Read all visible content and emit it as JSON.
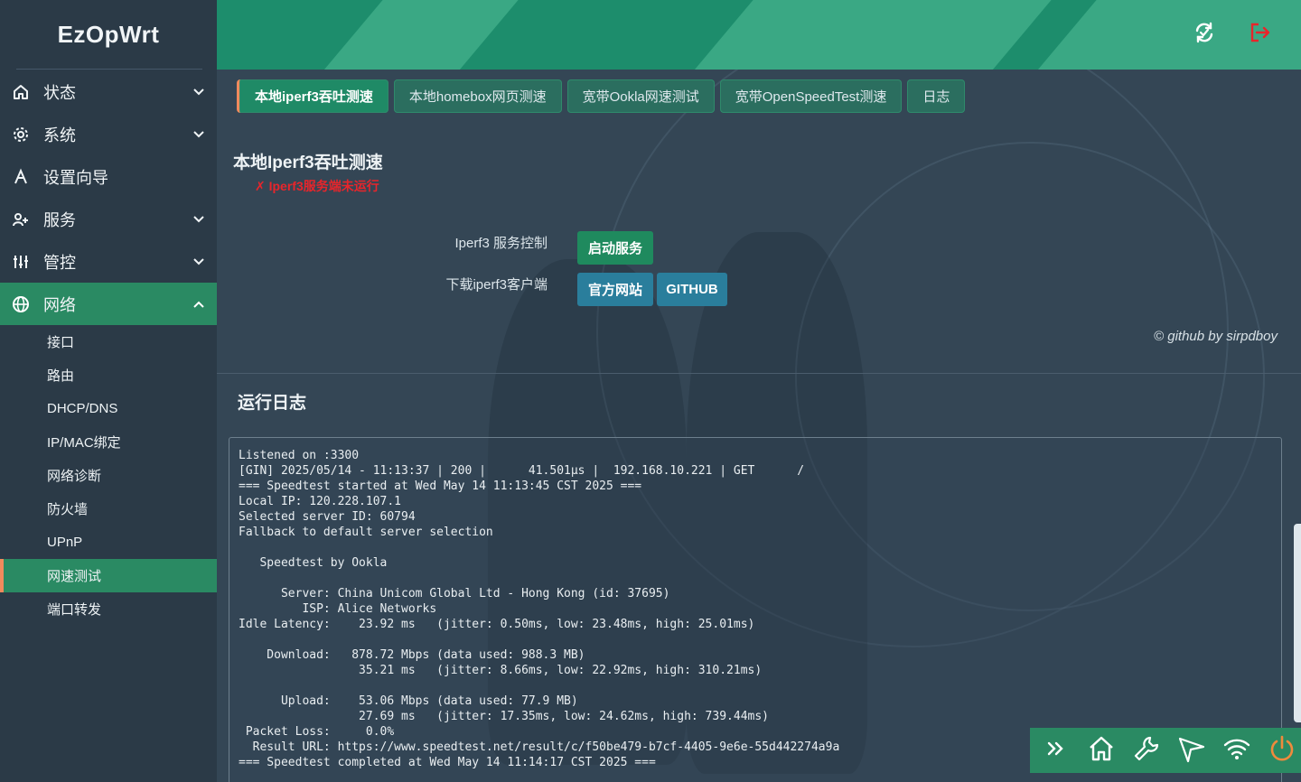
{
  "brand": {
    "name": "EzOpWrt"
  },
  "sidebar": {
    "items": [
      {
        "label": "状态",
        "icon": "home-icon",
        "expandable": true,
        "expanded": false
      },
      {
        "label": "系统",
        "icon": "gear-icon",
        "expandable": true,
        "expanded": false
      },
      {
        "label": "设置向导",
        "icon": "wizard-icon",
        "expandable": false
      },
      {
        "label": "服务",
        "icon": "user-plus-icon",
        "expandable": true,
        "expanded": false
      },
      {
        "label": "管控",
        "icon": "sliders-icon",
        "expandable": true,
        "expanded": false
      },
      {
        "label": "网络",
        "icon": "globe-icon",
        "expandable": true,
        "expanded": true,
        "active": true
      }
    ],
    "network_submenu": [
      {
        "label": "接口"
      },
      {
        "label": "路由"
      },
      {
        "label": "DHCP/DNS"
      },
      {
        "label": "IP/MAC绑定"
      },
      {
        "label": "网络诊断"
      },
      {
        "label": "防火墙"
      },
      {
        "label": "UPnP"
      },
      {
        "label": "网速测试",
        "active": true
      },
      {
        "label": "端口转发"
      }
    ]
  },
  "header": {
    "buttons": [
      {
        "icon": "refresh-icon"
      },
      {
        "icon": "logout-icon"
      }
    ]
  },
  "tabs": [
    {
      "label": "本地iperf3吞吐测速",
      "active": true
    },
    {
      "label": "本地homebox网页测速"
    },
    {
      "label": "宽带Ookla网速测试"
    },
    {
      "label": "宽带OpenSpeedTest测速"
    },
    {
      "label": "日志"
    }
  ],
  "section": {
    "title": "本地Iperf3吞吐测速",
    "status": "✗ Iperf3服务端未运行",
    "control_label": "Iperf3 服务控制",
    "start_button": "启动服务",
    "download_label": "下载iperf3客户端",
    "official_button": "官方网站",
    "github_button": "GITHUB",
    "credit": "© github by sirpdboy"
  },
  "log": {
    "title": "运行日志",
    "lines": [
      "Listened on :3300",
      "[GIN] 2025/05/14 - 11:13:37 | 200 |      41.501µs |  192.168.10.221 | GET      /",
      "=== Speedtest started at Wed May 14 11:13:45 CST 2025 ===",
      "Local IP: 120.228.107.1",
      "Selected server ID: 60794",
      "Fallback to default server selection",
      "",
      "   Speedtest by Ookla",
      "",
      "      Server: China Unicom Global Ltd - Hong Kong (id: 37695)",
      "         ISP: Alice Networks",
      "Idle Latency:    23.92 ms   (jitter: 0.50ms, low: 23.48ms, high: 25.01ms)",
      "",
      "    Download:   878.72 Mbps (data used: 988.3 MB)",
      "                 35.21 ms   (jitter: 8.66ms, low: 22.92ms, high: 310.21ms)",
      "",
      "      Upload:    53.06 Mbps (data used: 77.9 MB)",
      "                 27.69 ms   (jitter: 17.35ms, low: 24.62ms, high: 739.44ms)",
      " Packet Loss:     0.0%",
      "  Result URL: https://www.speedtest.net/result/c/f50be479-b7cf-4405-9e6e-55d442274a9a",
      "=== Speedtest completed at Wed May 14 11:14:17 CST 2025 ==="
    ]
  },
  "toolbar": {
    "icons": [
      "double-chevron-right-icon",
      "home-icon",
      "wrench-icon",
      "send-icon",
      "wifi-icon",
      "power-icon"
    ],
    "colors": {
      "power": "#f08a3c"
    }
  },
  "colors": {
    "accent_green": "#2a8a63",
    "accent_orange": "#f08a5d",
    "error_red": "#e8252b"
  }
}
